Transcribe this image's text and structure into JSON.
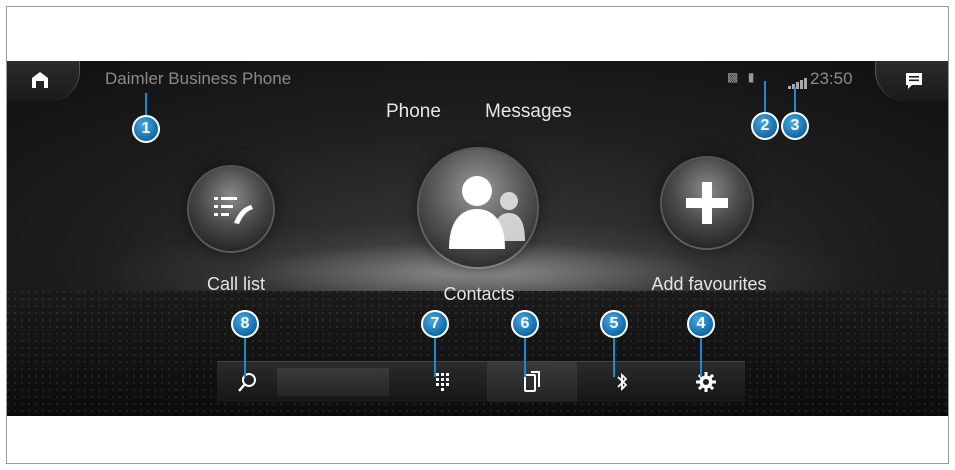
{
  "header": {
    "app_title": "Daimler Business Phone",
    "time": "23:50",
    "status_icons": [
      "sim-4g-icon",
      "battery-icon",
      "signal-strength-icon"
    ]
  },
  "tabs": [
    {
      "label": "Phone"
    },
    {
      "label": "Messages"
    }
  ],
  "main": {
    "call_list_label": "Call list",
    "contacts_label": "Contacts",
    "add_favourites_label": "Add favourites"
  },
  "toolbar": {
    "items": [
      "search-icon",
      "keypad-icon",
      "phone-device-icon",
      "bluetooth-icon",
      "settings-gear-icon"
    ]
  },
  "callouts": [
    "1",
    "2",
    "3",
    "4",
    "5",
    "6",
    "7",
    "8"
  ],
  "colors": {
    "callout": "#0e6aa8",
    "background": "#141414",
    "text": "#e4e4e4",
    "muted_text": "#8a8a8a"
  }
}
